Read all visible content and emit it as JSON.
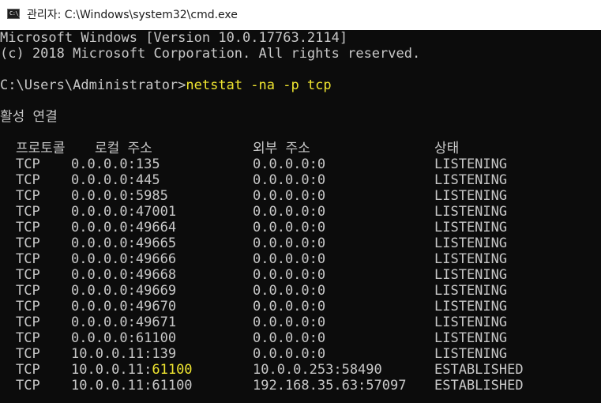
{
  "window": {
    "icon_text": "C:\\_",
    "title": "관리자: C:\\Windows\\system32\\cmd.exe"
  },
  "console": {
    "banner_line1": "Microsoft Windows [Version 10.0.17763.2114]",
    "banner_line2": "(c) 2018 Microsoft Corporation. All rights reserved.",
    "prompt": "C:\\Users\\Administrator>",
    "command": "netstat -na -p tcp",
    "section_title": "활성 연결",
    "headers": {
      "proto": "프로토콜",
      "local": "로컬 주소",
      "remote": "외부 주소",
      "state": "상태"
    },
    "rows": [
      {
        "proto": "TCP",
        "local_host": "0.0.0.0:",
        "local_port": "135",
        "remote": "0.0.0.0:0",
        "state": "LISTENING"
      },
      {
        "proto": "TCP",
        "local_host": "0.0.0.0:",
        "local_port": "445",
        "remote": "0.0.0.0:0",
        "state": "LISTENING"
      },
      {
        "proto": "TCP",
        "local_host": "0.0.0.0:",
        "local_port": "5985",
        "remote": "0.0.0.0:0",
        "state": "LISTENING"
      },
      {
        "proto": "TCP",
        "local_host": "0.0.0.0:",
        "local_port": "47001",
        "remote": "0.0.0.0:0",
        "state": "LISTENING"
      },
      {
        "proto": "TCP",
        "local_host": "0.0.0.0:",
        "local_port": "49664",
        "remote": "0.0.0.0:0",
        "state": "LISTENING"
      },
      {
        "proto": "TCP",
        "local_host": "0.0.0.0:",
        "local_port": "49665",
        "remote": "0.0.0.0:0",
        "state": "LISTENING"
      },
      {
        "proto": "TCP",
        "local_host": "0.0.0.0:",
        "local_port": "49666",
        "remote": "0.0.0.0:0",
        "state": "LISTENING"
      },
      {
        "proto": "TCP",
        "local_host": "0.0.0.0:",
        "local_port": "49668",
        "remote": "0.0.0.0:0",
        "state": "LISTENING"
      },
      {
        "proto": "TCP",
        "local_host": "0.0.0.0:",
        "local_port": "49669",
        "remote": "0.0.0.0:0",
        "state": "LISTENING"
      },
      {
        "proto": "TCP",
        "local_host": "0.0.0.0:",
        "local_port": "49670",
        "remote": "0.0.0.0:0",
        "state": "LISTENING"
      },
      {
        "proto": "TCP",
        "local_host": "0.0.0.0:",
        "local_port": "49671",
        "remote": "0.0.0.0:0",
        "state": "LISTENING"
      },
      {
        "proto": "TCP",
        "local_host": "0.0.0.0:",
        "local_port": "61100",
        "remote": "0.0.0.0:0",
        "state": "LISTENING"
      },
      {
        "proto": "TCP",
        "local_host": "10.0.0.11:",
        "local_port": "139",
        "remote": "0.0.0.0:0",
        "state": "LISTENING"
      },
      {
        "proto": "TCP",
        "local_host": "10.0.0.11:",
        "local_port": "61100",
        "remote": "10.0.0.253:58490",
        "state": "ESTABLISHED",
        "highlight": true
      },
      {
        "proto": "TCP",
        "local_host": "10.0.0.11:",
        "local_port": "61100",
        "remote": "192.168.35.63:57097",
        "state": "ESTABLISHED"
      }
    ]
  },
  "colors": {
    "background": "#0c0c0c",
    "text": "#c8c8c8",
    "command": "#f0e630",
    "titlebar": "#ffffff"
  }
}
